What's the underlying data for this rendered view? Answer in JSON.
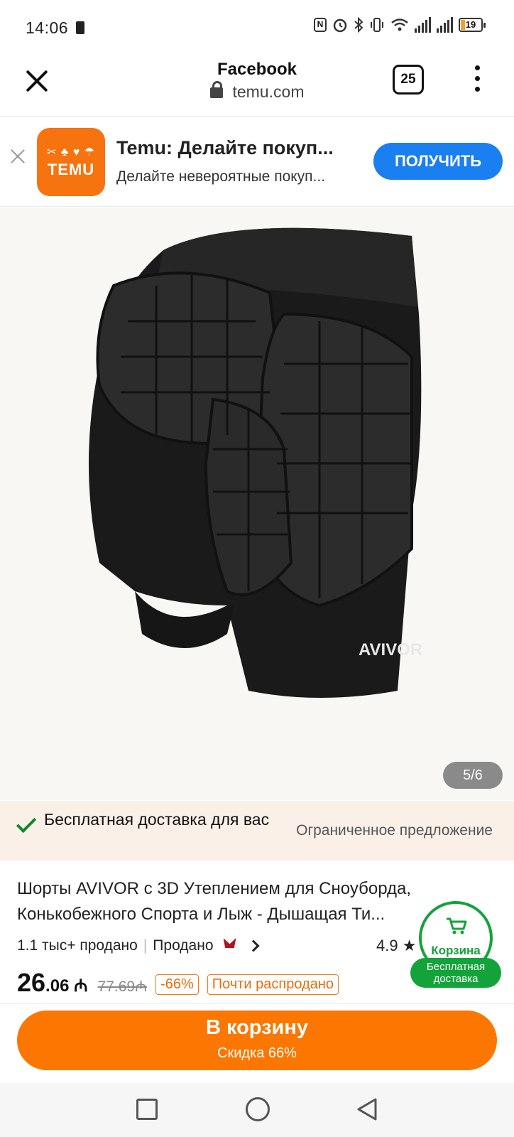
{
  "status_bar": {
    "time": "14:06",
    "battery": "19"
  },
  "browser": {
    "title": "Facebook",
    "url": "temu.com",
    "tab_count": "25"
  },
  "promo": {
    "logo_text": "TEMU",
    "title": "Temu: Делайте покуп...",
    "subtitle": "Делайте невероятные покуп...",
    "button": "ПОЛУЧИТЬ"
  },
  "gallery": {
    "counter": "5/6",
    "brand_print": "AVIVOR"
  },
  "shipping": {
    "label": "Бесплатная доставка для вас",
    "limited": "Ограниченное предложение"
  },
  "product": {
    "title": "Шорты AVIVOR с 3D Утеплением для Сноуборда, Конькобежного Спорта и Лыж - Дышащая Ти...",
    "sold": "1.1 тыс+ продано",
    "sold_by": "Продано",
    "rating": "4.9",
    "price_int": "26",
    "price_dec": ".06 ₼",
    "price_old": "77.69₼",
    "discount": "-66%",
    "stock_tag": "Почти распродано"
  },
  "cart_float": {
    "label": "Корзина",
    "badge": "Бесплатная доставка"
  },
  "cta": {
    "label": "В корзину",
    "sub": "Скидка 66%"
  },
  "colors": {
    "temu_orange": "#fb7701",
    "accent_blue": "#1a7ff0",
    "success_green": "#14a33a"
  }
}
